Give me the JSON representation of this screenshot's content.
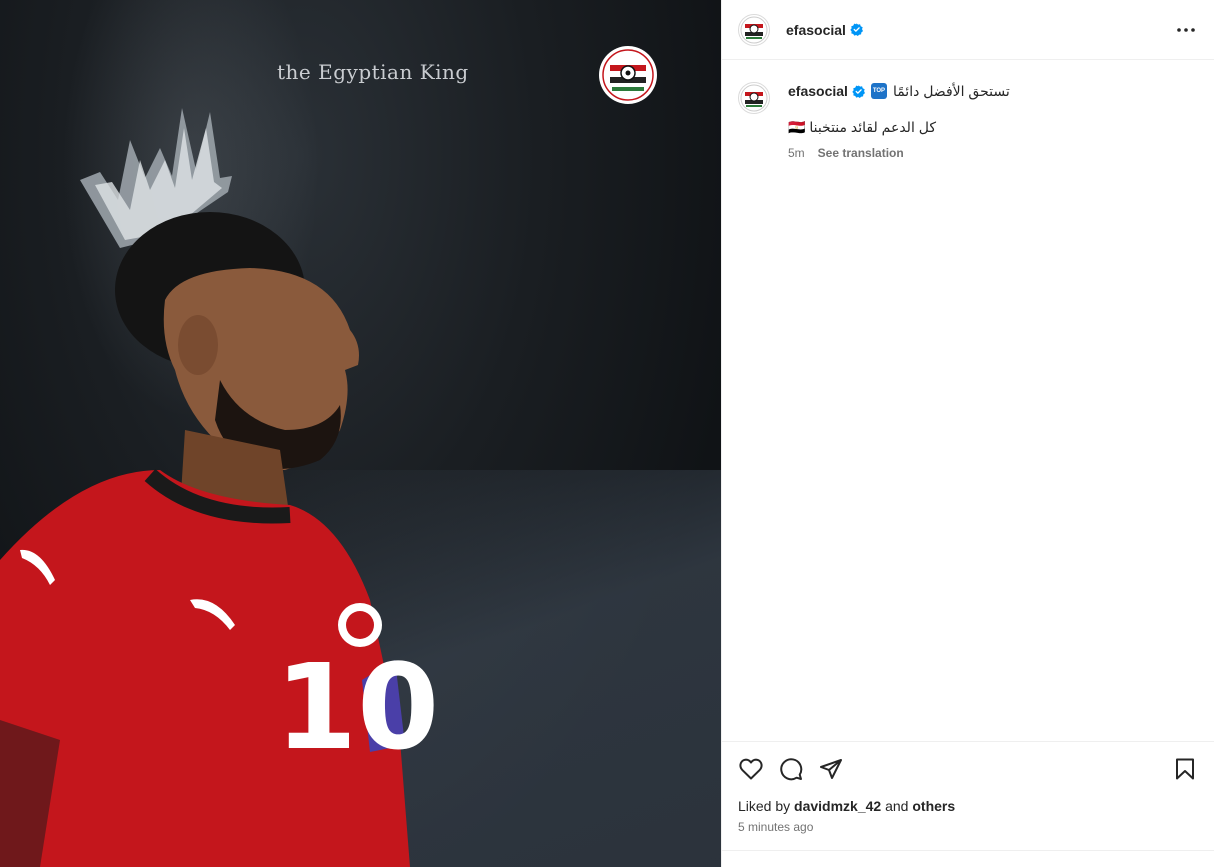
{
  "post": {
    "image_caption_overlay": "the Egyptian King",
    "jersey_number": "10"
  },
  "header": {
    "username": "efasocial"
  },
  "caption": {
    "username": "efasocial",
    "line1": "تستحق الأفضل دائمًا",
    "line1_emoji_text": "TOP",
    "line2": "كل الدعم لقائد منتخبنا 🇪🇬",
    "age": "5m",
    "see_translation": "See translation"
  },
  "likes": {
    "prefix": "Liked by",
    "user": "davidmzk_42",
    "joiner": "and",
    "others": "others"
  },
  "timestamp": "5 minutes ago",
  "colors": {
    "verified": "#0095f6",
    "jersey_red": "#c4161c",
    "text_secondary": "#737373"
  },
  "icons": [
    "heart-icon",
    "comment-icon",
    "share-icon",
    "bookmark-icon",
    "more-icon",
    "verified-icon"
  ]
}
